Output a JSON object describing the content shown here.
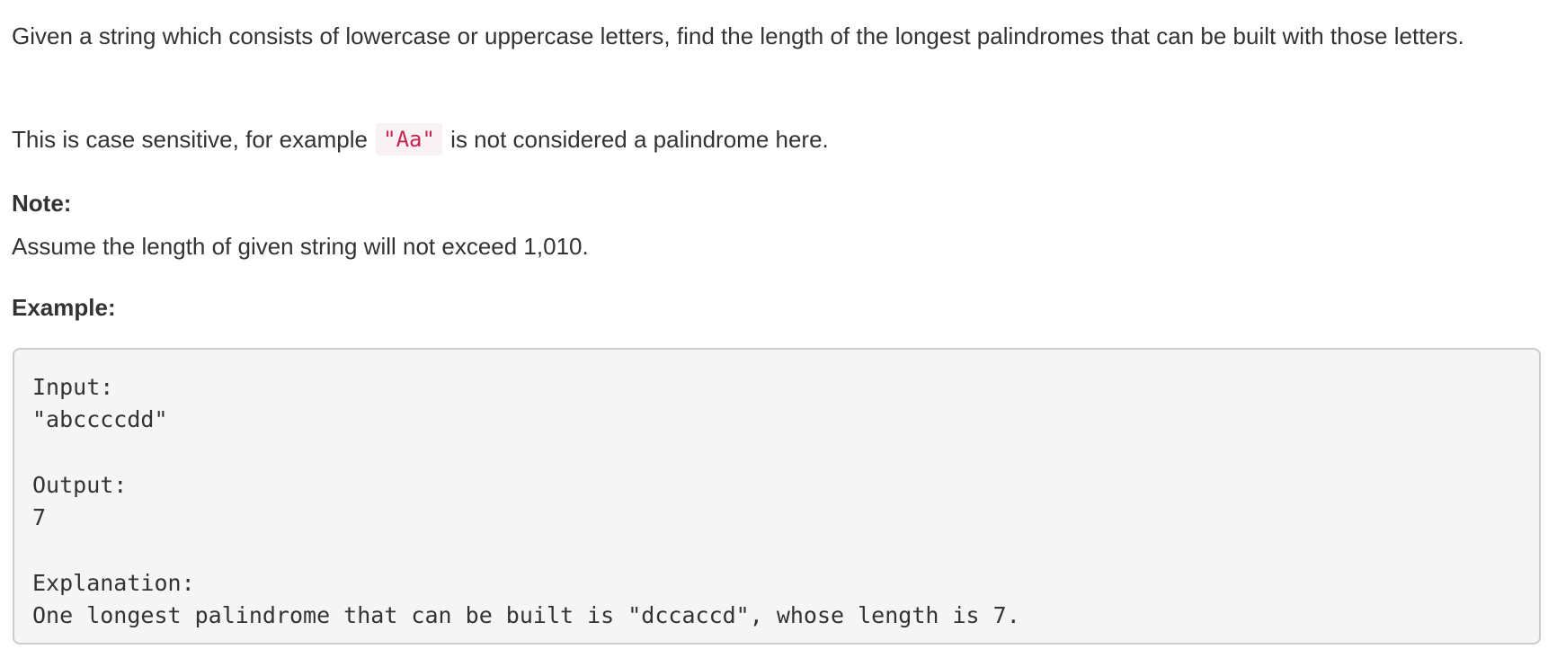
{
  "problem": {
    "description": "Given a string which consists of lowercase or uppercase letters, find the length of the longest palindromes that can be built with those letters.",
    "case_sentence": {
      "before": "This is case sensitive, for example ",
      "code": "\"Aa\"",
      "after": " is not considered a palindrome here."
    },
    "note": {
      "heading": "Note:",
      "text": "Assume the length of given string will not exceed 1,010."
    },
    "example": {
      "heading": "Example:",
      "lines": [
        "Input:",
        "\"abccccdd\"",
        "",
        "Output:",
        "7",
        "",
        "Explanation:",
        "One longest palindrome that can be built is \"dccaccd\", whose length is 7."
      ]
    }
  }
}
